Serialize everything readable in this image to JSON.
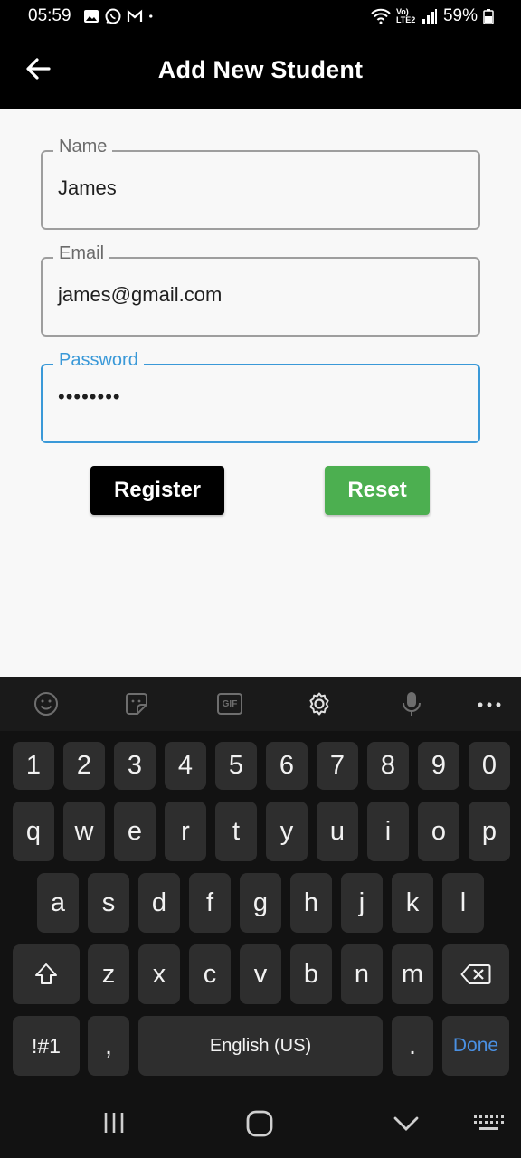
{
  "status_bar": {
    "time": "05:59",
    "network": "Vo) LTE2",
    "battery": "59%"
  },
  "app_bar": {
    "title": "Add New Student",
    "back_icon": "arrow-left-icon"
  },
  "form": {
    "name": {
      "label": "Name",
      "value": "James"
    },
    "email": {
      "label": "Email",
      "value": "james@gmail.com"
    },
    "password": {
      "label": "Password",
      "value": "••••••••"
    },
    "register_label": "Register",
    "reset_label": "Reset",
    "colors": {
      "focus": "#3a99d8",
      "reset": "#4caf50",
      "register": "#000000"
    }
  },
  "keyboard": {
    "toolbar": [
      "emoji-icon",
      "sticker-icon",
      "gif-icon",
      "settings-icon",
      "mic-icon",
      "more-icon"
    ],
    "gif_label": "GIF",
    "row_numbers": [
      "1",
      "2",
      "3",
      "4",
      "5",
      "6",
      "7",
      "8",
      "9",
      "0"
    ],
    "row_1": [
      "q",
      "w",
      "e",
      "r",
      "t",
      "y",
      "u",
      "i",
      "o",
      "p"
    ],
    "row_2": [
      "a",
      "s",
      "d",
      "f",
      "g",
      "h",
      "j",
      "k",
      "l"
    ],
    "row_3": [
      "z",
      "x",
      "c",
      "v",
      "b",
      "n",
      "m"
    ],
    "symbols_label": "!#1",
    "comma_label": ",",
    "space_label": "English (US)",
    "period_label": ".",
    "done_label": "Done"
  }
}
